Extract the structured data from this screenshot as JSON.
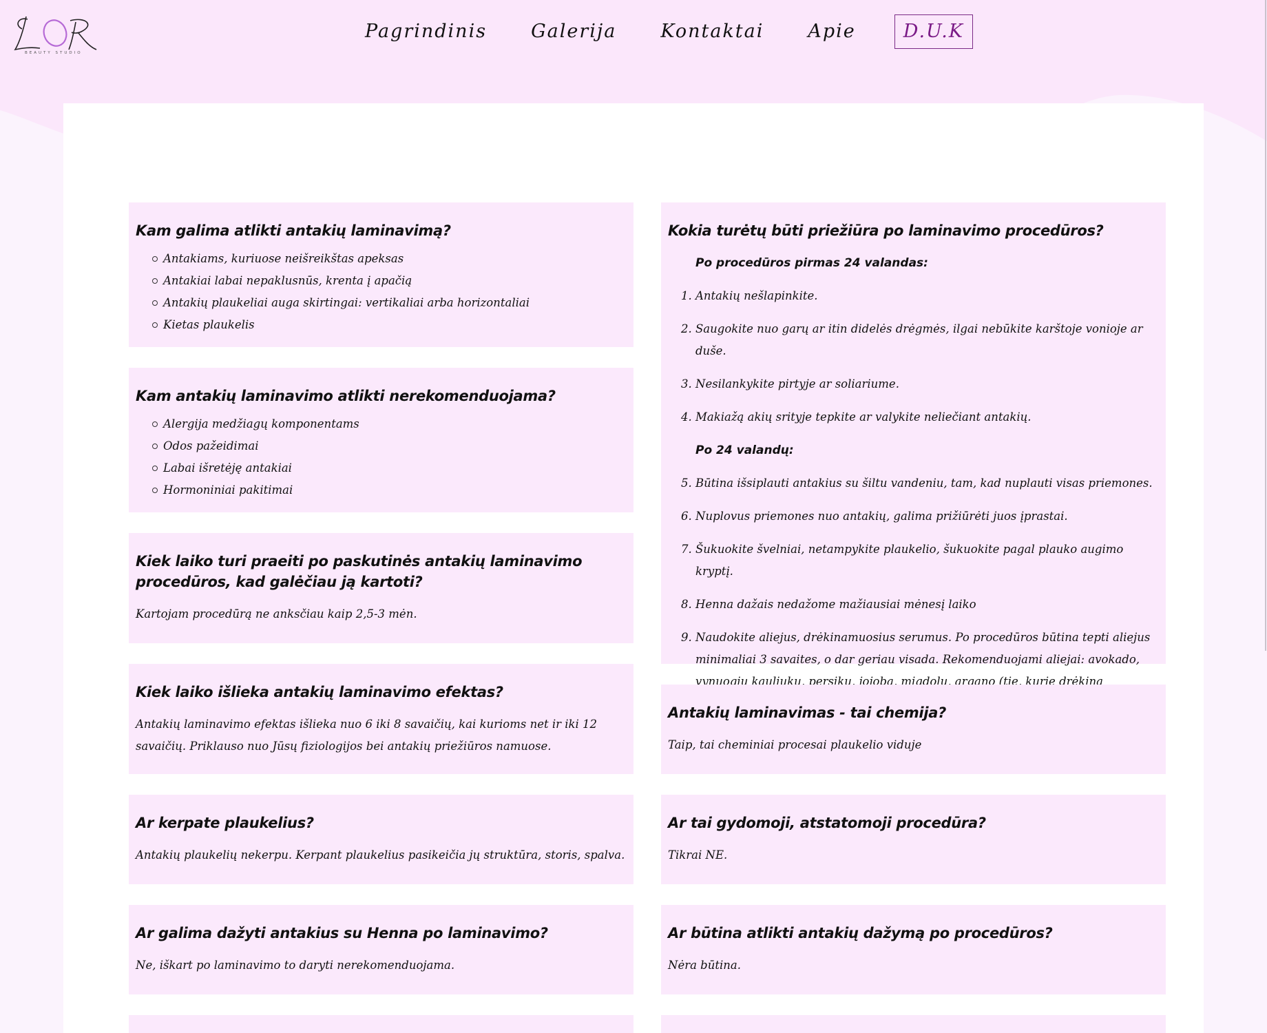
{
  "logo": {
    "text": "LOR",
    "subtitle": "BEAUTY STUDIO"
  },
  "nav": {
    "items": [
      {
        "label": "Pagrindinis"
      },
      {
        "label": "Galerija"
      },
      {
        "label": "Kontaktai"
      },
      {
        "label": "Apie"
      },
      {
        "label": "D.U.K"
      }
    ],
    "active": "D.U.K"
  },
  "colors": {
    "card_bg": "#fbe9fc",
    "accent": "#7a1a86",
    "page_bg": "#fbf3fd"
  },
  "faq_left": [
    {
      "question": "Kam galima atlikti antakių laminavimą?",
      "bullets": [
        "Antakiams, kuriuose neišreikštas apeksas",
        "Antakiai labai nepaklusnūs, krenta į apačią",
        "Antakių plaukeliai auga skirtingai: vertikaliai arba horizontaliai",
        "Kietas plaukelis"
      ]
    },
    {
      "question": "Kam antakių laminavimo atlikti nerekomenduojama?",
      "bullets": [
        "Alergija medžiagų komponentams",
        "Odos pažeidimai",
        "Labai išretėję antakiai",
        "Hormoniniai pakitimai"
      ]
    },
    {
      "question": "Kiek laiko turi praeiti po paskutinės antakių laminavimo procedūros, kad galėčiau ją kartoti?",
      "answer": "Kartojam procedūrą ne anksčiau kaip 2,5-3 mėn."
    },
    {
      "question": "Kiek laiko išlieka antakių laminavimo efektas?",
      "answer": "Antakių laminavimo efektas išlieka nuo 6 iki 8 savaičių, kai kurioms net ir iki 12 savaičių. Priklauso nuo Jūsų fiziologijos bei antakių priežiūros namuose."
    },
    {
      "question": "Ar kerpate plaukelius?",
      "answer": "Antakių plaukelių nekerpu. Kerpant plaukelius pasikeičia jų struktūra, storis, spalva."
    },
    {
      "question": "Ar galima dažyti antakius su Henna po laminavimo?",
      "answer": "Ne, iškart po laminavimo to daryti nerekomenduojama."
    }
  ],
  "faq_right": [
    {
      "question": "Kokia turėtų būti priežiūra po laminavimo procedūros?",
      "subhead1": "Po procedūros pirmas 24 valandas:",
      "steps1": [
        "Antakių nešlapinkite.",
        "Saugokite nuo garų ar itin didelės drėgmės, ilgai nebūkite karštoje vonioje ar duše.",
        "Nesilankykite pirtyje ar soliariume.",
        "Makiažą akių srityje tepkite ar valykite neliečiant antakių."
      ],
      "subhead2": "Po 24 valandų:",
      "steps2": [
        "Būtina išsiplauti antakius su šiltu vandeniu, tam, kad nuplauti visas priemones.",
        "Nuplovus priemones nuo antakių, galima prižiūrėti juos įprastai.",
        "Šukuokite švelniai, netampykite plaukelio, šukuokite pagal plauko augimo kryptį.",
        "Henna dažais nedažome mažiausiai mėnesį laiko",
        "Naudokite aliejus, drėkinamuosius serumus. Po procedūros būtina tepti aliejus minimaliai 3 savaites, o dar geriau visada. Rekomenduojami aliejai: avokado, vynuogių kauliukų, persikų, jojoba, migdolu, argano (tie, kurie drėkina plaukelį)."
      ]
    },
    {
      "question": "Antakių laminavimas - tai chemija?",
      "answer": "Taip, tai cheminiai procesai plaukelio viduje"
    },
    {
      "question": "Ar tai gydomoji, atstatomoji procedūra?",
      "answer": "Tikrai NE."
    },
    {
      "question": "Ar būtina atlikti antakių dažymą po procedūros?",
      "answer": "Nėra būtina."
    }
  ]
}
